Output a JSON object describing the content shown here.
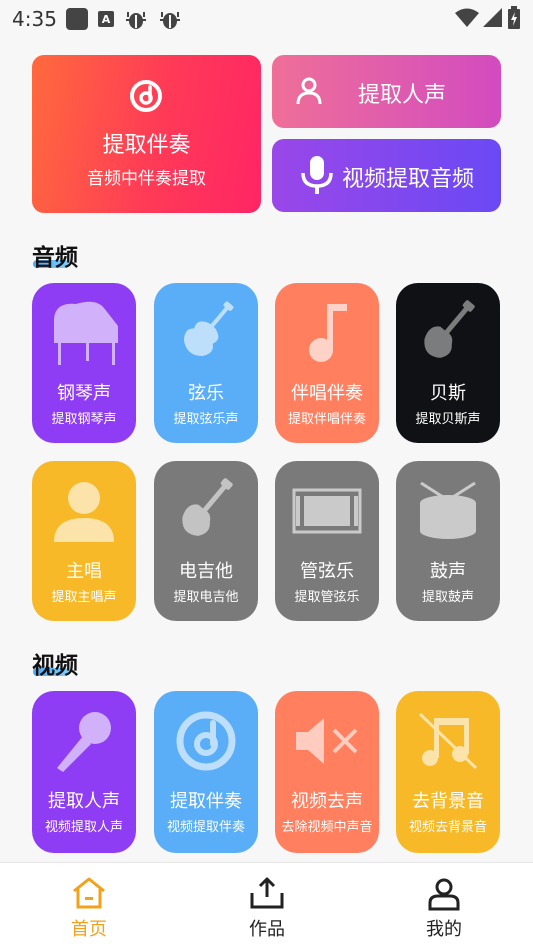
{
  "status": {
    "time": "4:35"
  },
  "hero": {
    "main_title": "提取伴奏",
    "main_sub": "音频中伴奏提取",
    "vocal_label": "提取人声",
    "audio_label": "视频提取音频"
  },
  "sections": {
    "audio": "音频",
    "video": "视频"
  },
  "audio_tiles": [
    {
      "title": "钢琴声",
      "sub": "提取钢琴声"
    },
    {
      "title": "弦乐",
      "sub": "提取弦乐声"
    },
    {
      "title": "伴唱伴奏",
      "sub": "提取伴唱伴奏"
    },
    {
      "title": "贝斯",
      "sub": "提取贝斯声"
    },
    {
      "title": "主唱",
      "sub": "提取主唱声"
    },
    {
      "title": "电吉他",
      "sub": "提取电吉他"
    },
    {
      "title": "管弦乐",
      "sub": "提取管弦乐"
    },
    {
      "title": "鼓声",
      "sub": "提取鼓声"
    }
  ],
  "video_tiles": [
    {
      "title": "提取人声",
      "sub": "视频提取人声"
    },
    {
      "title": "提取伴奏",
      "sub": "视频提取伴奏"
    },
    {
      "title": "视频去声",
      "sub": "去除视频中声音"
    },
    {
      "title": "去背景音",
      "sub": "视频去背景音"
    }
  ],
  "nav": {
    "home": "首页",
    "works": "作品",
    "mine": "我的"
  },
  "colors": {
    "purple": "#8f3df5",
    "blue": "#5aaef8",
    "orange": "#ff7f5f",
    "black": "#101114",
    "yellow": "#f7b928",
    "gray": "#7a7a7a",
    "accent": "#f2a21a"
  }
}
